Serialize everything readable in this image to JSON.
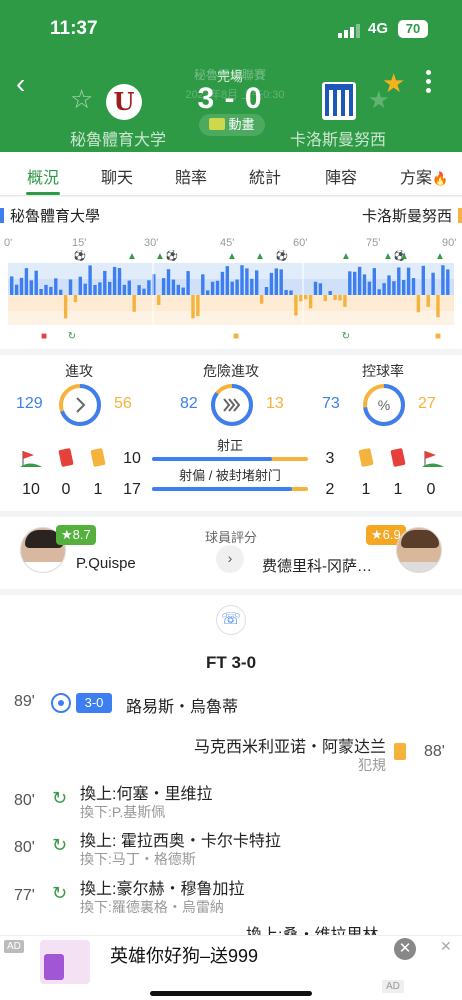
{
  "status_bar": {
    "time": "11:37",
    "network": "4G",
    "battery": "70"
  },
  "match": {
    "status": "完場",
    "ghost_league": "秘魯甲級聯賽",
    "ghost_date": "2023年8月 上午0:30",
    "score": "3 - 0",
    "animation_label": "動畫",
    "home_team": "秘魯體育大学",
    "away_team": "卡洛斯曼努西"
  },
  "tabs": [
    {
      "label": "概況",
      "active": true
    },
    {
      "label": "聊天"
    },
    {
      "label": "賠率"
    },
    {
      "label": "統計"
    },
    {
      "label": "陣容"
    },
    {
      "label": "方案"
    }
  ],
  "momentum": {
    "home_name": "秘魯體育大學",
    "away_name": "卡洛斯曼努西",
    "minute_labels": [
      "0'",
      "15'",
      "30'",
      "45'",
      "60'",
      "75'",
      "90'"
    ],
    "colors": {
      "home": "#3d7ff0",
      "away": "#f5b33d"
    }
  },
  "stats": {
    "attack": {
      "title": "進攻",
      "home": "129",
      "away": "56",
      "icon": "chevron-right-icon"
    },
    "danger": {
      "title": "危險進攻",
      "home": "82",
      "away": "13",
      "icon": "double-chevron-icon"
    },
    "possession": {
      "title": "控球率",
      "home": "73",
      "away": "27",
      "icon": "percent-icon"
    },
    "home_corners": "10",
    "home_red": "0",
    "home_yellow": "1",
    "away_yellow": "1",
    "away_red": "1",
    "away_corners": "0",
    "shots_on_label": "射正",
    "shots_on_home": "10",
    "shots_on_away": "3",
    "shots_off_label": "射偏 / 被封堵射门",
    "shots_off_home": "17",
    "shots_off_away": "2"
  },
  "player_rating": {
    "title": "球員評分",
    "home_player": "P.Quispe",
    "home_rating": "★8.7",
    "away_player": "费德里科-冈萨…",
    "away_rating": "★6.9"
  },
  "events": {
    "ft_label": "FT 3-0",
    "items": [
      {
        "minute": "89'",
        "badge": "3-0",
        "main": "路易斯・烏魯蒂"
      },
      {
        "minute": "88'",
        "main": "马克西米利亚诺・阿蒙达兰",
        "sub": "犯規"
      },
      {
        "minute": "80'",
        "main": "換上:何塞・里维拉",
        "sub": "換下:P.基斯佩"
      },
      {
        "minute": "80'",
        "main": "換上: 霍拉西奥・卡尔卡特拉",
        "sub": "換下:马丁・格德斯"
      },
      {
        "minute": "77'",
        "main": "換上:豪尔赫・穆鲁加拉",
        "sub": "換下:羅德裏格・烏雷納"
      },
      {
        "minute": "",
        "main": "換上:桑・维拉里林"
      }
    ]
  },
  "ad": {
    "tag": "AD",
    "text": "英雄你好狗–送999",
    "tag2": "AD"
  }
}
